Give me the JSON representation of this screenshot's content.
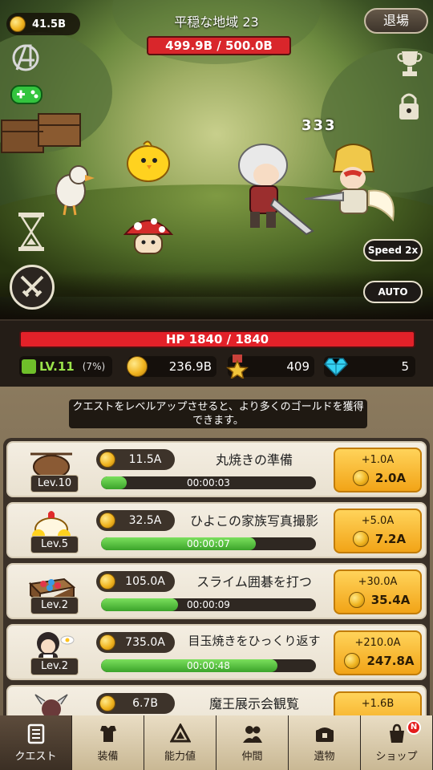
{
  "hud": {
    "gold": "41.5B",
    "stage_title": "平穏な地域 23",
    "boss_hp": "499.9B / 500.0B",
    "exit_label": "退場",
    "speed_label": "Speed 2x",
    "auto_label": "AUTO",
    "damage_text": "333"
  },
  "status": {
    "hp_text": "HP 1840 / 1840",
    "level": "LV.11",
    "level_pct": "(7%)",
    "gold": "236.9B",
    "medals": "409",
    "gems": "5"
  },
  "quest": {
    "hint": "クエストをレベルアップさせると、より多くのゴールドを獲得できます。",
    "rows": [
      {
        "level": "Lev.10",
        "cost": "11.5A",
        "name": "丸焼きの準備",
        "progress": 0.12,
        "time": "00:00:03",
        "gain": "+1.0A",
        "price": "2.0A"
      },
      {
        "level": "Lev.5",
        "cost": "32.5A",
        "name": "ひよこの家族写真撮影",
        "progress": 0.72,
        "time": "00:00:07",
        "gain": "+5.0A",
        "price": "7.2A"
      },
      {
        "level": "Lev.2",
        "cost": "105.0A",
        "name": "スライム囲碁を打つ",
        "progress": 0.36,
        "time": "00:00:09",
        "gain": "+30.0A",
        "price": "35.4A"
      },
      {
        "level": "Lev.2",
        "cost": "735.0A",
        "name": "目玉焼きをひっくり返す",
        "progress": 0.82,
        "time": "00:00:48",
        "gain": "+210.0A",
        "price": "247.8A"
      },
      {
        "level": "",
        "cost": "6.7B",
        "name": "魔王展示会観覧",
        "progress": 0.0,
        "time": "",
        "gain": "+1.6B",
        "price": ""
      }
    ]
  },
  "nav": [
    {
      "label": "クエスト",
      "icon": "scroll-icon",
      "active": true
    },
    {
      "label": "装備",
      "icon": "armor-icon",
      "active": false
    },
    {
      "label": "能力値",
      "icon": "stats-icon",
      "active": false
    },
    {
      "label": "仲間",
      "icon": "friends-icon",
      "active": false
    },
    {
      "label": "遺物",
      "icon": "chest-icon",
      "active": false
    },
    {
      "label": "ショップ",
      "icon": "shop-bag-icon",
      "active": false,
      "badge": "N"
    }
  ],
  "colors": {
    "accent_gold": "#f2a417",
    "hp_red": "#e32129",
    "progress_green": "#3ba32a",
    "level_green": "#9ae34b"
  }
}
